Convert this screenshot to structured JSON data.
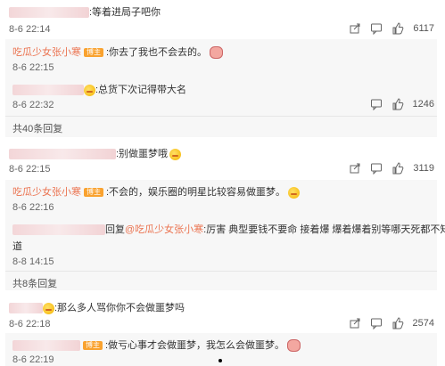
{
  "comments": [
    {
      "text": ":等着进局子吧你",
      "time": "8-6 22:14",
      "likes": "6117"
    },
    {
      "text": ":别做噩梦哦",
      "time": "8-6 22:15",
      "likes": "3119"
    },
    {
      "text": ":那么多人骂你你不会做噩梦吗",
      "time": "8-6 22:18",
      "likes": "2574"
    }
  ],
  "replies1": [
    {
      "name": "吃瓜少女张小寒",
      "badge": "博主",
      "text": ":你去了我也不会去的。",
      "time": "8-6 22:15"
    },
    {
      "text": ":总货下次记得带大名",
      "time": "8-6 22:32",
      "likes": "1246"
    }
  ],
  "replies1_more": "共40条回复",
  "replies2": [
    {
      "name": "吃瓜少女张小寒",
      "badge": "博主",
      "text": ":不会的，娱乐圈的明星比较容易做噩梦。",
      "time": "8-6 22:16"
    },
    {
      "reply_label": "回复",
      "mention": "@吃瓜少女张小寒",
      "text_line1": ":厉害 典型要钱不要命 接着爆 爆着爆着别等哪天死都不知",
      "text_line2": "道",
      "time": "8-8 14:15"
    }
  ],
  "replies2_more": "共8条回复",
  "replies3": [
    {
      "name": "",
      "badge": "博主",
      "text": ":做亏心事才会做噩梦，我怎么会做噩梦。",
      "time": "8-6 22:19"
    }
  ],
  "icons": [
    "share-icon",
    "comment-icon",
    "like-icon"
  ]
}
